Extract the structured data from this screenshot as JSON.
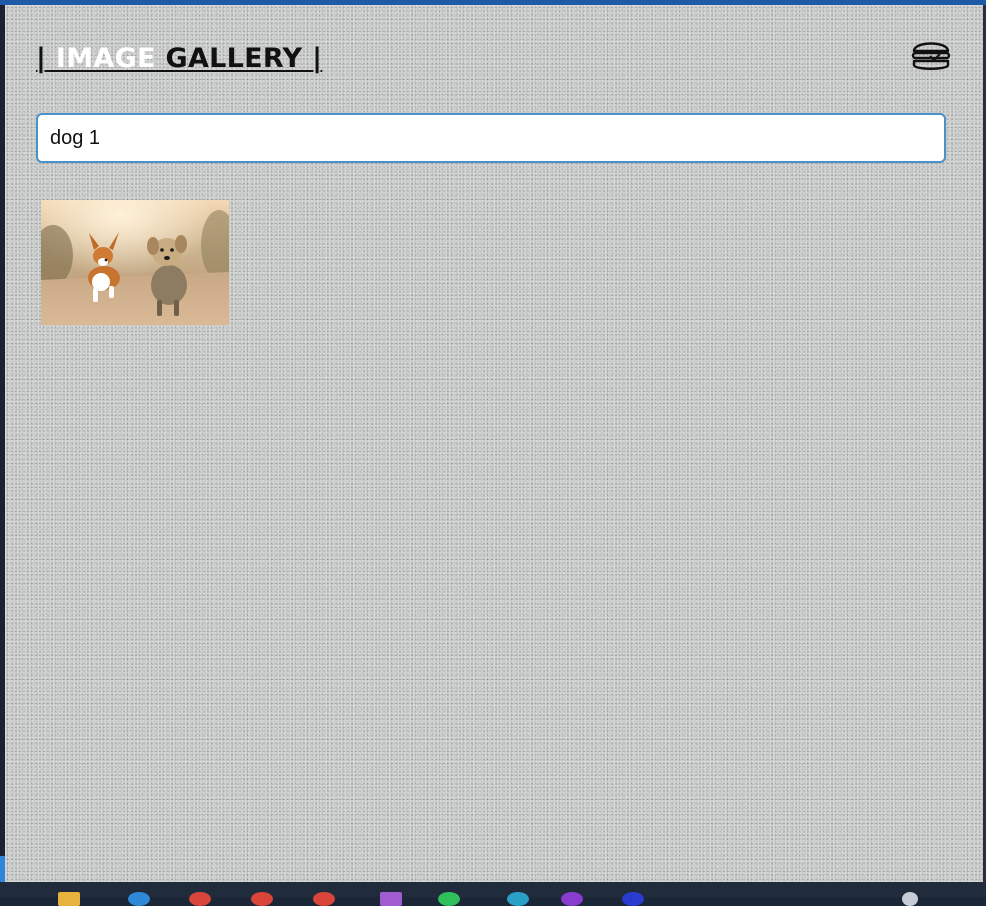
{
  "header": {
    "title_prefix": "|",
    "title_word1": " IMAGE",
    "title_word2": " GALLERY ",
    "title_suffix": "|",
    "menu_icon": "hamburger-icon"
  },
  "search": {
    "value": "dog 1",
    "placeholder": ""
  },
  "gallery": {
    "images": [
      {
        "subject": "corgi and yorkshire terrier running on dirt road"
      }
    ]
  },
  "taskbar": {
    "icons": [
      "file-explorer-icon",
      "edge-icon",
      "chrome-icon",
      "chrome-icon",
      "chrome-icon",
      "onenote-icon",
      "whatsapp-icon",
      "vscode-icon",
      "app-icon",
      "app-icon",
      "system-icon"
    ]
  },
  "colors": {
    "accent": "#1f5aa6",
    "search_border": "#4a90c9",
    "title_highlight": "#ffffff",
    "title_text": "#111111"
  }
}
